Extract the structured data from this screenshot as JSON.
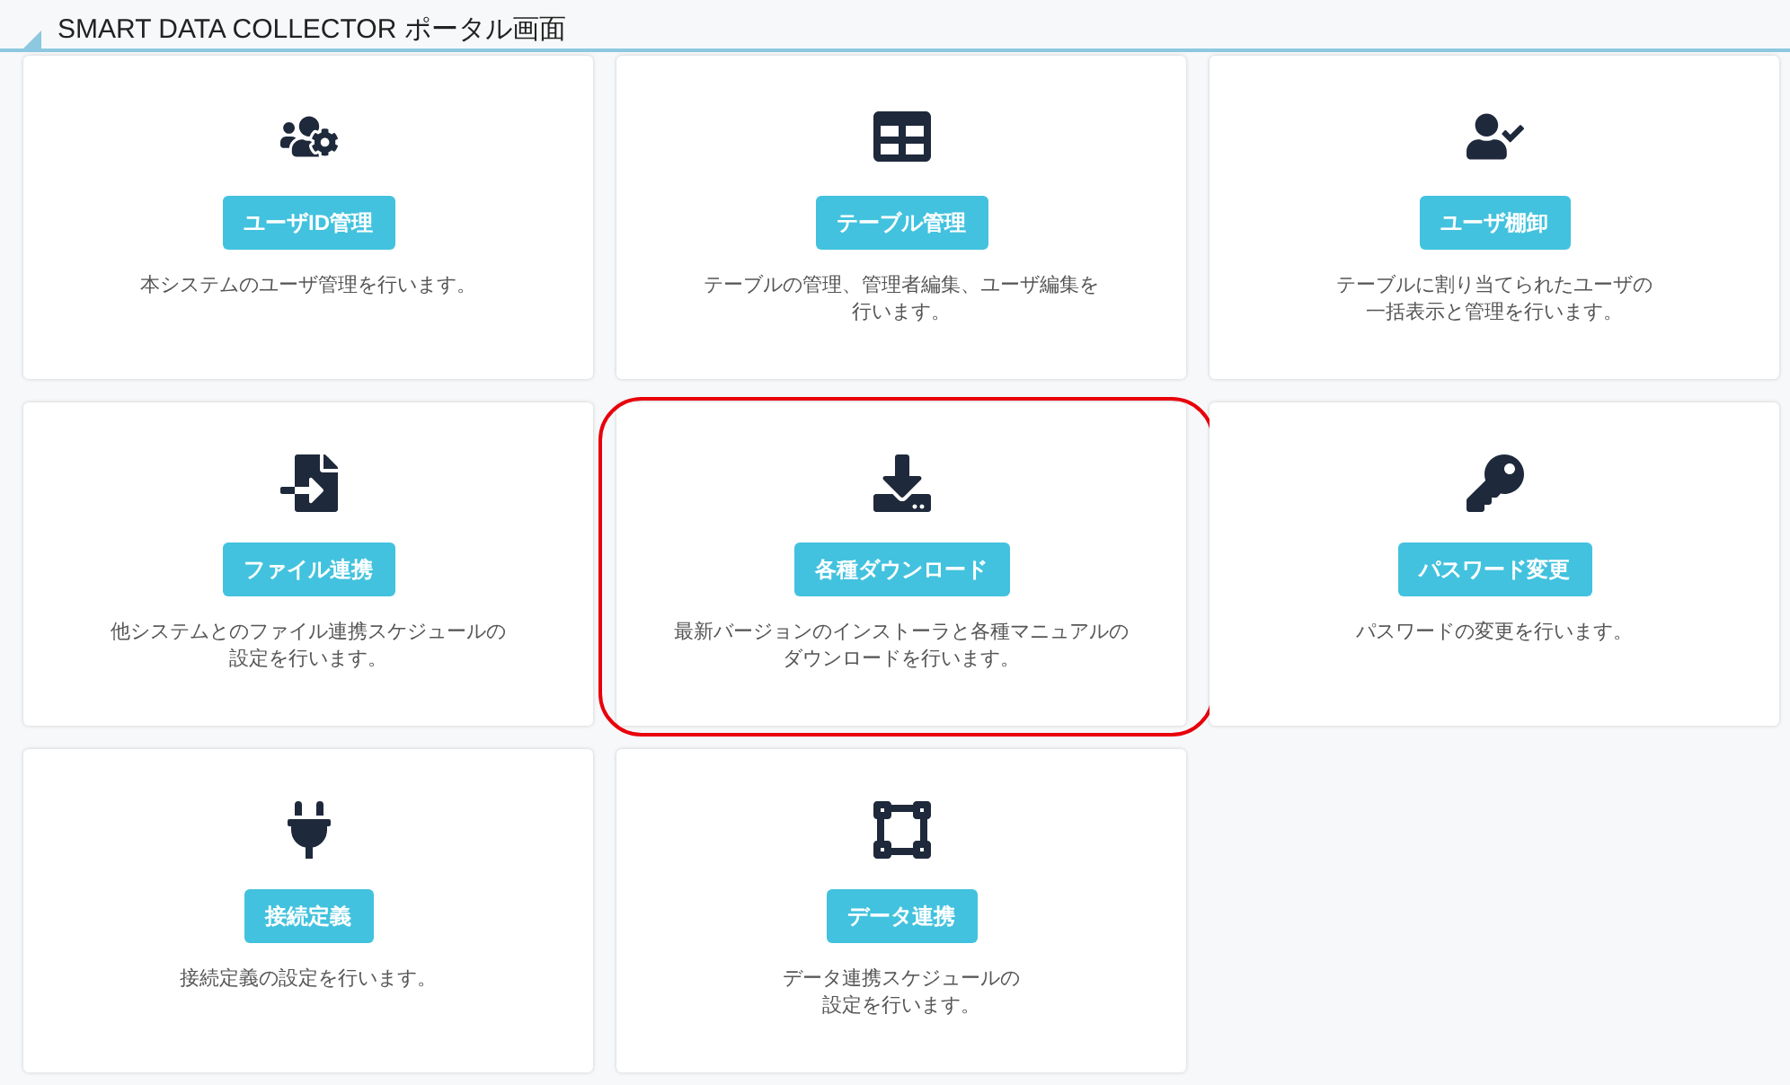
{
  "header": {
    "title": "SMART DATA COLLECTOR ポータル画面"
  },
  "cards": [
    {
      "button": "ユーザID管理",
      "description_lines": [
        "本システムのユーザ管理を行います。"
      ],
      "highlighted": false
    },
    {
      "button": "テーブル管理",
      "description_lines": [
        "テーブルの管理、管理者編集、ユーザ編集を",
        "行います。"
      ],
      "highlighted": false
    },
    {
      "button": "ユーザ棚卸",
      "description_lines": [
        "テーブルに割り当てられたユーザの",
        "一括表示と管理を行います。"
      ],
      "highlighted": false
    },
    {
      "button": "ファイル連携",
      "description_lines": [
        "他システムとのファイル連携スケジュールの",
        "設定を行います。"
      ],
      "highlighted": false
    },
    {
      "button": "各種ダウンロード",
      "description_lines": [
        "最新バージョンのインストーラと各種マニュアルの",
        "ダウンロードを行います。"
      ],
      "highlighted": true
    },
    {
      "button": "パスワード変更",
      "description_lines": [
        "パスワードの変更を行います。"
      ],
      "highlighted": false
    },
    {
      "button": "接続定義",
      "description_lines": [
        "接続定義の設定を行います。"
      ],
      "highlighted": false
    },
    {
      "button": "データ連携",
      "description_lines": [
        "データ連携スケジュールの",
        "設定を行います。"
      ],
      "highlighted": false
    }
  ]
}
